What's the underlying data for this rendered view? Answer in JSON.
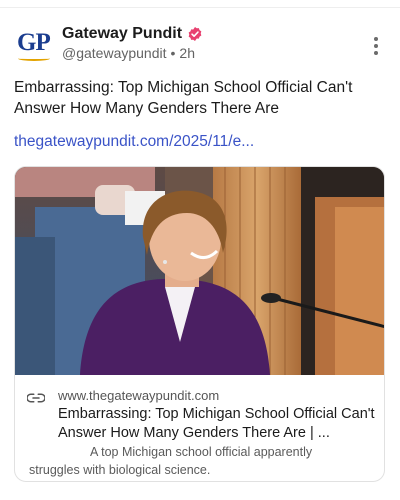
{
  "post": {
    "author": {
      "display_name": "Gateway Pundit",
      "handle": "@gatewaypundit",
      "separator": "•",
      "time_ago": "2h",
      "avatar_text": "GP",
      "avatar_icon": "gateway-pundit-logo"
    },
    "verified_icon": "verified-badge-icon",
    "more_icon": "more-options-icon",
    "text": "Embarrassing: Top Michigan School Official Can't Answer How Many Genders There Are",
    "link_text": "thegatewaypundit.com/2025/11/e...",
    "link_card": {
      "image_icon": "article-thumbnail",
      "link_icon": "link-icon",
      "domain": "www.thegatewaypundit.com",
      "title": "Embarrassing: Top Michigan School Official Can't Answer How Many Genders There Are | ...",
      "description_line1": "A top Michigan school official apparently",
      "description_line2": "struggles with biological science."
    }
  },
  "colors": {
    "link": "#3a53c7",
    "avatar_blue": "#1b3d8f",
    "avatar_gold": "#e3a300",
    "verified": "#e8406f"
  }
}
